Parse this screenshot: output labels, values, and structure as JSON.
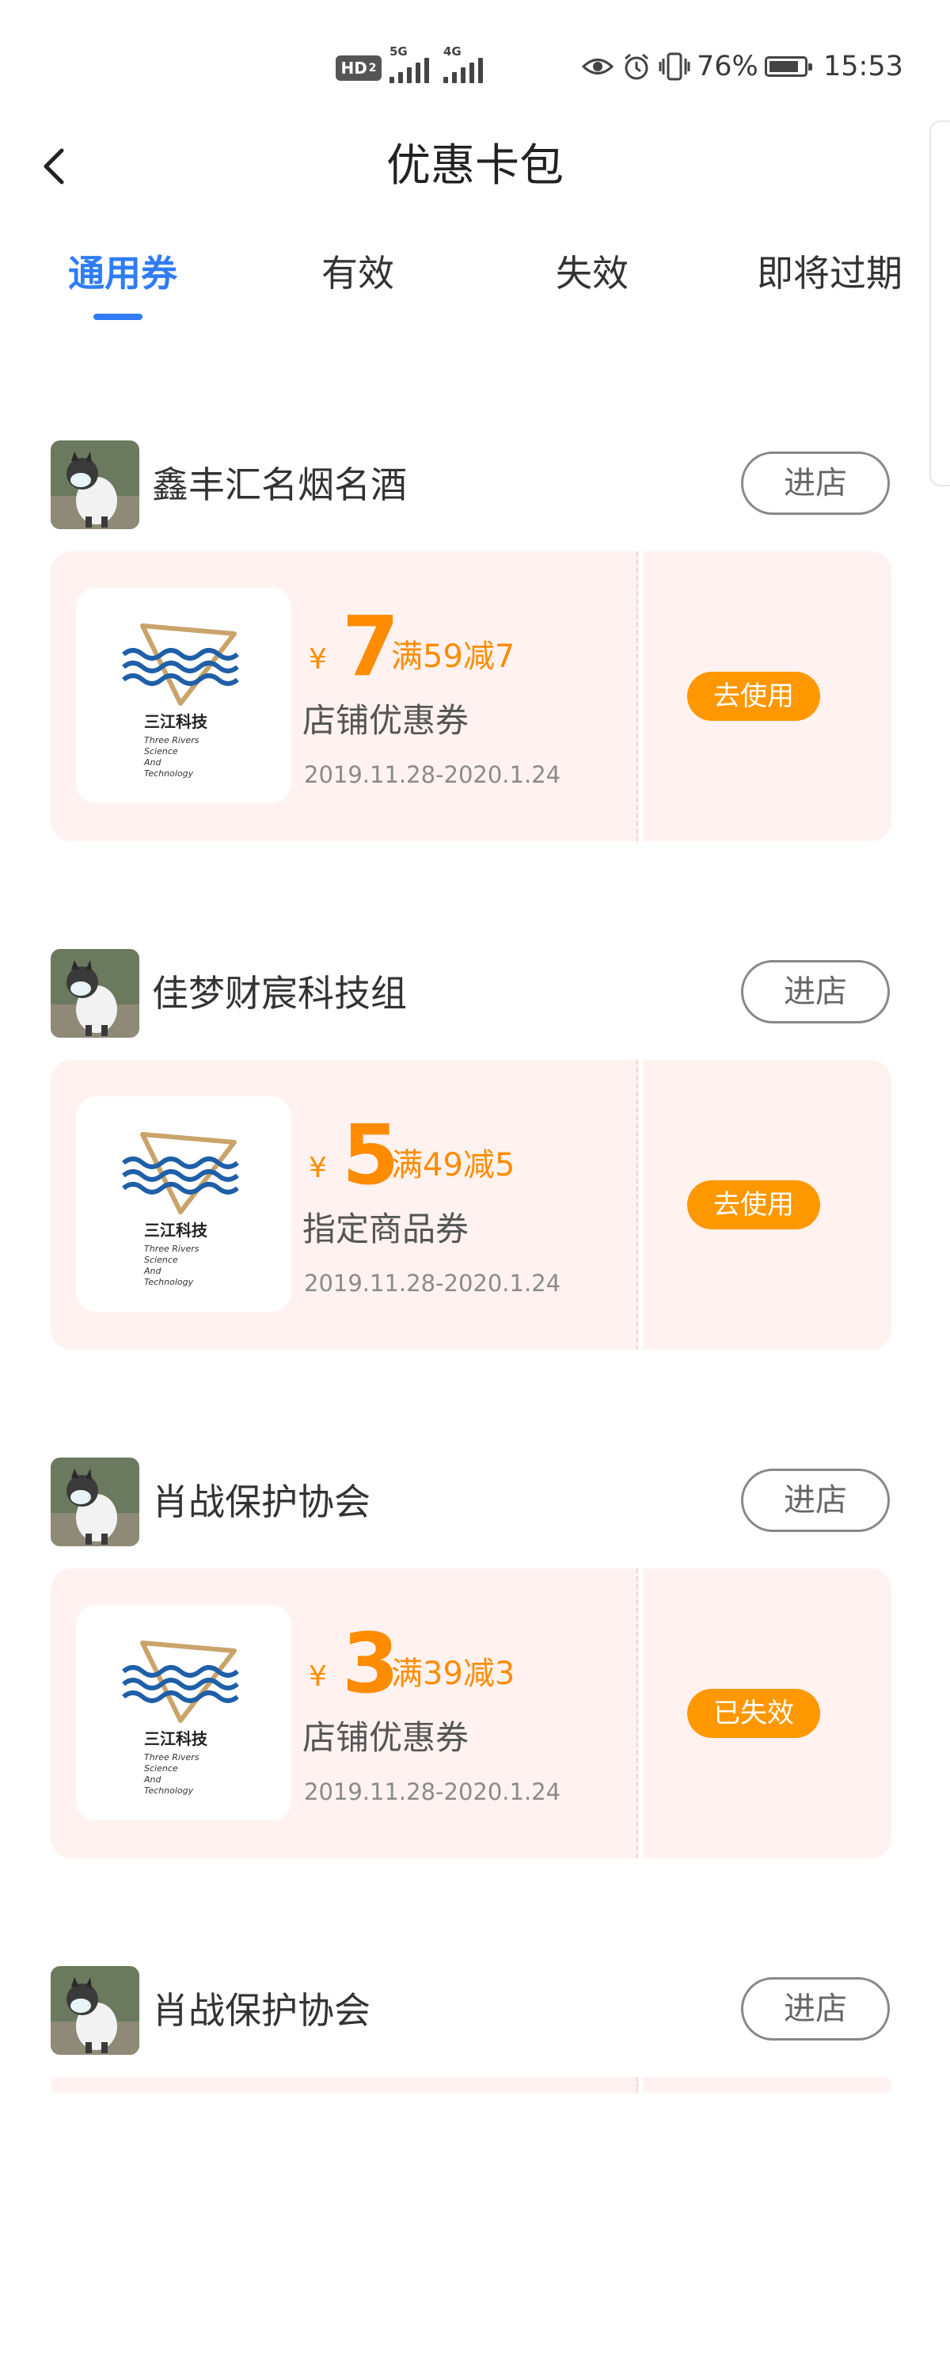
{
  "status_bar": {
    "hd_label": "HD",
    "hd_sub": "2",
    "net1": "5G",
    "net2": "4G",
    "battery_text": "76%",
    "time": "15:53",
    "icons": [
      "eye-icon",
      "alarm-icon",
      "vibrate-icon",
      "battery-icon"
    ]
  },
  "header": {
    "title": "优惠卡包",
    "back_icon": "chevron-left-icon"
  },
  "tabs": [
    {
      "label": "通用券",
      "active": true
    },
    {
      "label": "有效",
      "active": false
    },
    {
      "label": "失效",
      "active": false
    },
    {
      "label": "即将过期",
      "active": false
    }
  ],
  "stores": [
    {
      "name": "鑫丰汇名烟名酒",
      "enter_label": "进店",
      "coupon": {
        "currency": "¥",
        "amount": "7",
        "rule": "满59减7",
        "type": "店铺优惠券",
        "date": "2019.11.28-2020.1.24",
        "action": "去使用",
        "logo": {
          "brand": "三江科技",
          "line1": "Three Rivers",
          "line2": "Science",
          "line3": "And",
          "line4": "Technology"
        }
      }
    },
    {
      "name": "佳梦财宸科技组",
      "enter_label": "进店",
      "coupon": {
        "currency": "¥",
        "amount": "5",
        "rule": "满49减5",
        "type": "指定商品券",
        "date": "2019.11.28-2020.1.24",
        "action": "去使用",
        "logo": {
          "brand": "三江科技",
          "line1": "Three Rivers",
          "line2": "Science",
          "line3": "And",
          "line4": "Technology"
        }
      }
    },
    {
      "name": "肖战保护协会",
      "enter_label": "进店",
      "coupon": {
        "currency": "¥",
        "amount": "3",
        "rule": "满39减3",
        "type": "店铺优惠券",
        "date": "2019.11.28-2020.1.24",
        "action": "已失效",
        "logo": {
          "brand": "三江科技",
          "line1": "Three Rivers",
          "line2": "Science",
          "line3": "And",
          "line4": "Technology"
        }
      }
    },
    {
      "name": "肖战保护协会",
      "enter_label": "进店"
    }
  ],
  "colors": {
    "accent_blue": "#2f7cf6",
    "coupon_orange": "#ff9800",
    "coupon_bg": "#fff2f0"
  }
}
